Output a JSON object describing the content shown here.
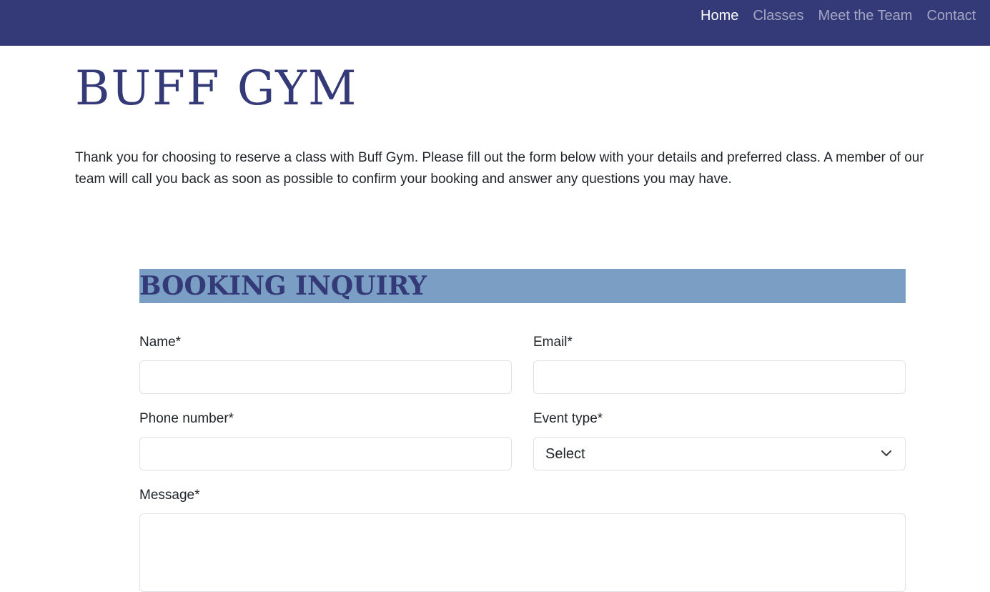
{
  "nav": {
    "links": [
      {
        "label": "Home",
        "active": true
      },
      {
        "label": "Classes",
        "active": false
      },
      {
        "label": "Meet the Team",
        "active": false
      },
      {
        "label": "Contact",
        "active": false
      }
    ]
  },
  "brand": {
    "title": "BUFF GYM"
  },
  "intro": {
    "text": "Thank you for choosing to reserve a class with Buff Gym. Please fill out the form below with your details and preferred class. A member of our team will call you back as soon as possible to confirm your booking and answer any questions you may have."
  },
  "form": {
    "heading": "BOOKING INQUIRY",
    "name_label": "Name*",
    "name_value": "",
    "email_label": "Email*",
    "email_value": "",
    "phone_label": "Phone number*",
    "phone_value": "",
    "event_label": "Event type*",
    "event_selected": "Select",
    "message_label": "Message*",
    "message_value": ""
  },
  "colors": {
    "navbar": "#333a77",
    "brand": "#333a77",
    "heading_bg": "#7a9ec4"
  },
  "icons": {
    "select_arrow": "chevron-down-icon"
  }
}
